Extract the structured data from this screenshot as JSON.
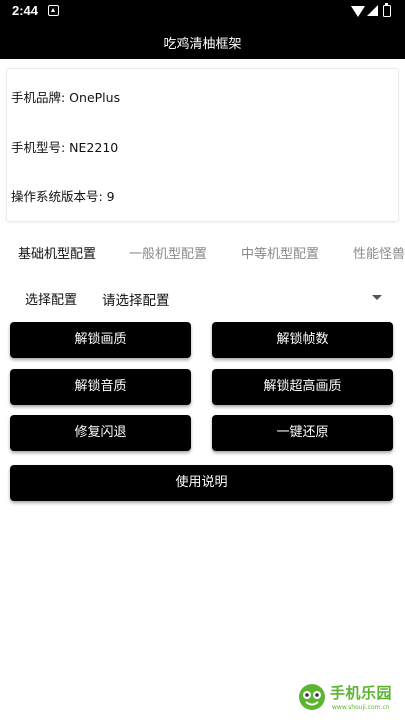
{
  "status_bar": {
    "time": "2:44"
  },
  "app_bar": {
    "title": "吃鸡清柚框架"
  },
  "device_info": {
    "brand": "手机品牌: OnePlus",
    "model": "手机型号: NE2210",
    "os_version": "操作系统版本号: 9"
  },
  "tabs": [
    {
      "label": "基础机型配置",
      "active": true
    },
    {
      "label": "一般机型配置",
      "active": false
    },
    {
      "label": "中等机型配置",
      "active": false
    },
    {
      "label": "性能怪兽",
      "active": false
    }
  ],
  "config_select": {
    "label": "选择配置",
    "value": "请选择配置"
  },
  "actions": {
    "unlock_quality": "解锁画质",
    "unlock_fps": "解锁帧数",
    "unlock_audio": "解锁音质",
    "unlock_ultra_quality": "解锁超高画质",
    "fix_crash": "修复闪退",
    "one_click_restore": "一键还原",
    "instructions": "使用说明"
  },
  "watermark": {
    "brand": "手机乐园",
    "url": "www.shouji.com.cn"
  },
  "colors": {
    "bar": "#000000",
    "button": "#000000",
    "watermark": "#5cb531"
  }
}
